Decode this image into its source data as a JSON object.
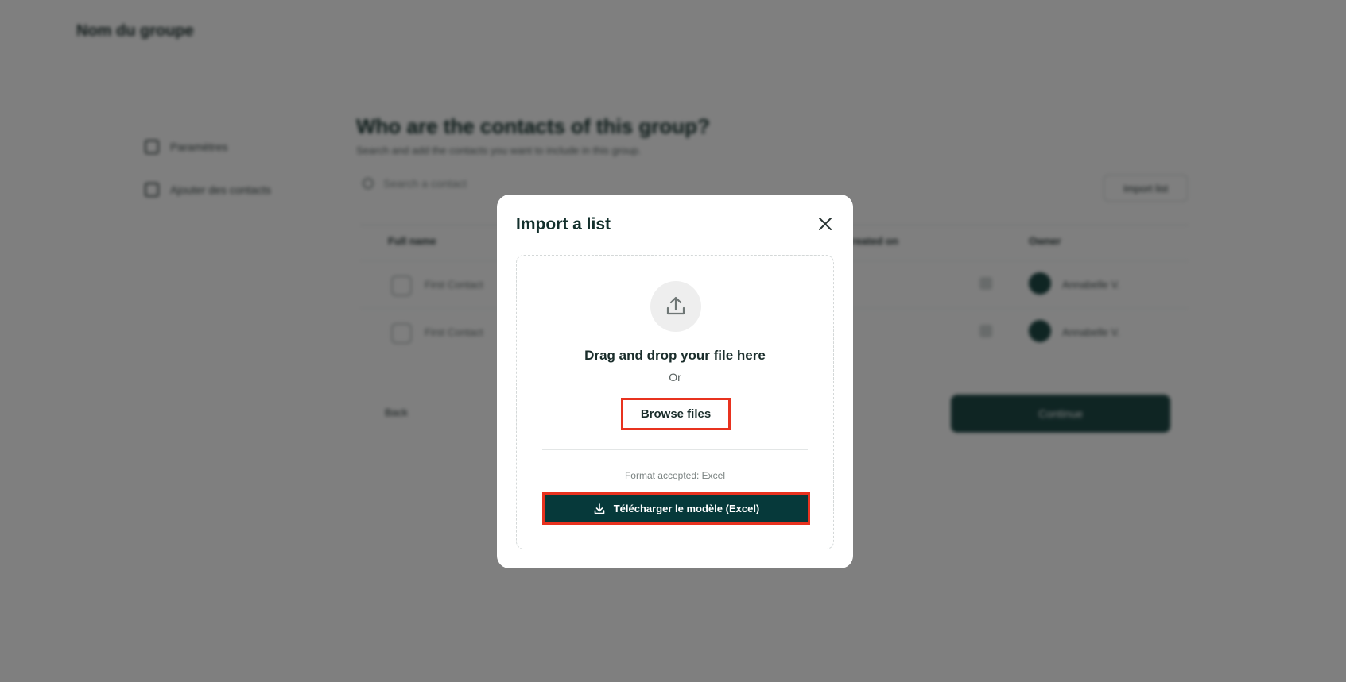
{
  "background": {
    "logo": "Nom du groupe",
    "sidebar": [
      {
        "label": "Paramètres"
      },
      {
        "label": "Ajouter des contacts"
      }
    ],
    "title": "Who are the contacts of this group?",
    "subtitle": "Search and add the contacts you want to include in this group.",
    "search_placeholder": "Search a contact",
    "import_button": "Import list",
    "table_headers": [
      "Full name",
      "Created on",
      "Owner"
    ],
    "rows": [
      {
        "name": "First Contact",
        "owner": "Annabelle V."
      },
      {
        "name": "First Contact",
        "owner": "Annabelle V."
      }
    ],
    "back_label": "Back",
    "continue_label": "Continue"
  },
  "modal": {
    "title": "Import a list",
    "close_icon": "close-icon",
    "upload_icon": "upload-icon",
    "dropzone_title": "Drag and drop your file here",
    "or_label": "Or",
    "browse_label": "Browse files",
    "format_text": "Format accepted: Excel",
    "download_icon": "download-icon",
    "download_label": "Télécharger le modèle (Excel)"
  },
  "colors": {
    "primary": "#06393a",
    "highlight": "#e8321f",
    "overlay": "rgba(0,0,0,0.5)"
  }
}
